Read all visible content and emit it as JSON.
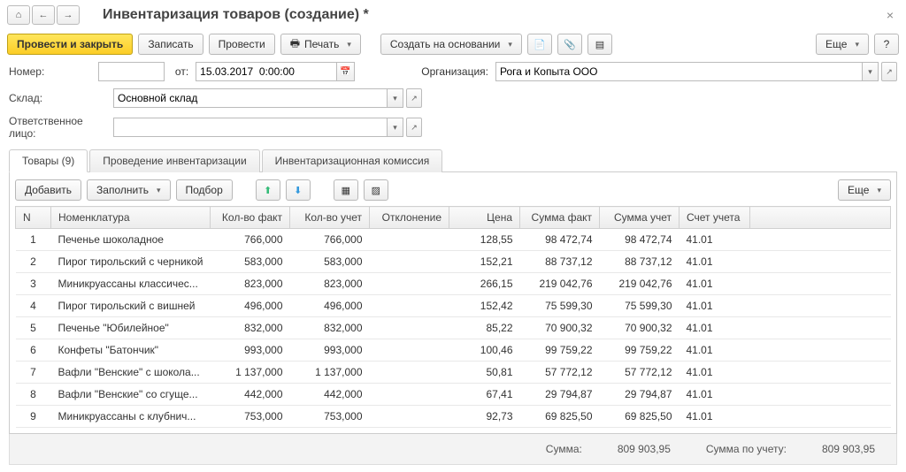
{
  "header": {
    "title": "Инвентаризация товаров (создание) *"
  },
  "toolbar": {
    "process_close": "Провести и закрыть",
    "save": "Записать",
    "process": "Провести",
    "print": "Печать",
    "create_based": "Создать на основании",
    "more": "Еще"
  },
  "form": {
    "number_label": "Номер:",
    "number_value": "",
    "from_label": "от:",
    "date_value": "15.03.2017  0:00:00",
    "org_label": "Организация:",
    "org_value": "Рога и Копыта ООО",
    "warehouse_label": "Склад:",
    "warehouse_value": "Основной склад",
    "responsible_label": "Ответственное лицо:",
    "responsible_value": ""
  },
  "tabs": {
    "goods": "Товары (9)",
    "inventory": "Проведение инвентаризации",
    "committee": "Инвентаризационная комиссия"
  },
  "grid_toolbar": {
    "add": "Добавить",
    "fill": "Заполнить",
    "selection": "Подбор",
    "more": "Еще"
  },
  "columns": {
    "n": "N",
    "name": "Номенклатура",
    "qty_fact": "Кол-во факт",
    "qty_acc": "Кол-во учет",
    "dev": "Отклонение",
    "price": "Цена",
    "sum_fact": "Сумма факт",
    "sum_acc": "Сумма учет",
    "account": "Счет учета"
  },
  "rows": [
    {
      "n": "1",
      "name": "Печенье шоколадное",
      "qf": "766,000",
      "qu": "766,000",
      "dev": "",
      "price": "128,55",
      "sf": "98 472,74",
      "su": "98 472,74",
      "acc": "41.01"
    },
    {
      "n": "2",
      "name": "Пирог тирольский с черникой",
      "qf": "583,000",
      "qu": "583,000",
      "dev": "",
      "price": "152,21",
      "sf": "88 737,12",
      "su": "88 737,12",
      "acc": "41.01"
    },
    {
      "n": "3",
      "name": "Миникруассаны классичес...",
      "qf": "823,000",
      "qu": "823,000",
      "dev": "",
      "price": "266,15",
      "sf": "219 042,76",
      "su": "219 042,76",
      "acc": "41.01"
    },
    {
      "n": "4",
      "name": "Пирог тирольский с вишней",
      "qf": "496,000",
      "qu": "496,000",
      "dev": "",
      "price": "152,42",
      "sf": "75 599,30",
      "su": "75 599,30",
      "acc": "41.01"
    },
    {
      "n": "5",
      "name": "Печенье \"Юбилейное\"",
      "qf": "832,000",
      "qu": "832,000",
      "dev": "",
      "price": "85,22",
      "sf": "70 900,32",
      "su": "70 900,32",
      "acc": "41.01"
    },
    {
      "n": "6",
      "name": "Конфеты \"Батончик\"",
      "qf": "993,000",
      "qu": "993,000",
      "dev": "",
      "price": "100,46",
      "sf": "99 759,22",
      "su": "99 759,22",
      "acc": "41.01"
    },
    {
      "n": "7",
      "name": "Вафли \"Венские\" с шокола...",
      "qf": "1 137,000",
      "qu": "1 137,000",
      "dev": "",
      "price": "50,81",
      "sf": "57 772,12",
      "su": "57 772,12",
      "acc": "41.01"
    },
    {
      "n": "8",
      "name": "Вафли \"Венские\" со сгуще...",
      "qf": "442,000",
      "qu": "442,000",
      "dev": "",
      "price": "67,41",
      "sf": "29 794,87",
      "su": "29 794,87",
      "acc": "41.01"
    },
    {
      "n": "9",
      "name": "Миникруассаны с клубнич...",
      "qf": "753,000",
      "qu": "753,000",
      "dev": "",
      "price": "92,73",
      "sf": "69 825,50",
      "su": "69 825,50",
      "acc": "41.01"
    }
  ],
  "totals": {
    "sum_label": "Сумма:",
    "sum_value": "809 903,95",
    "sum_acc_label": "Сумма по учету:",
    "sum_acc_value": "809 903,95"
  }
}
